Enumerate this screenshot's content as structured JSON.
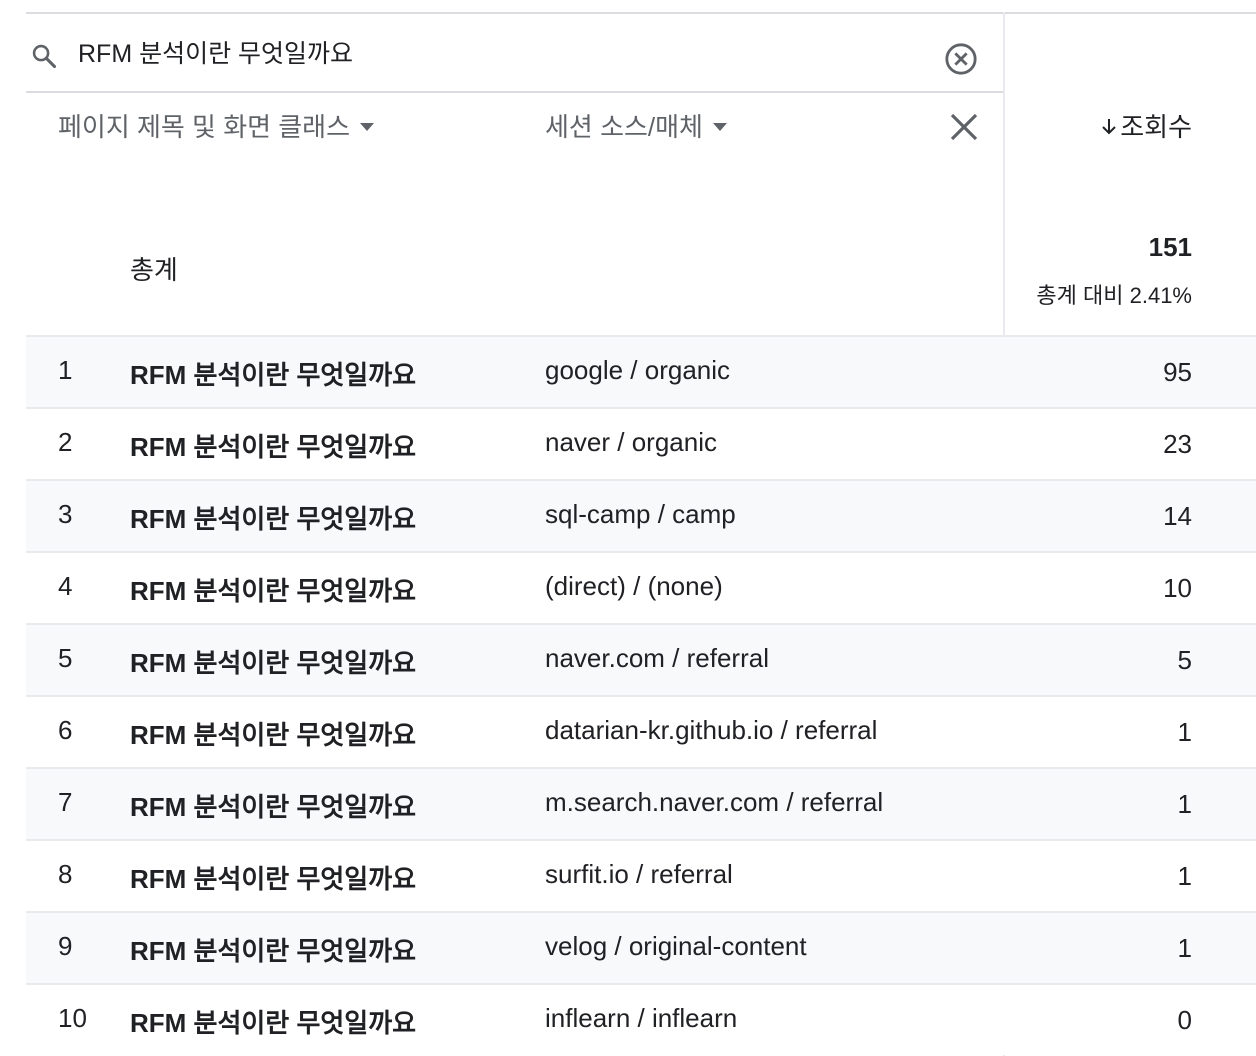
{
  "search": {
    "value": "RFM 분석이란 무엇일까요",
    "placeholder": ""
  },
  "columns": {
    "dimension1": "페이지 제목 및 화면 클래스",
    "dimension2": "세션 소스/매체",
    "metric": "조회수"
  },
  "totals": {
    "label": "총계",
    "value": "151",
    "sub": "총계 대비 2.41%"
  },
  "rows": [
    {
      "index": "1",
      "page": "RFM 분석이란 무엇일까요",
      "source": "google / organic",
      "views": "95"
    },
    {
      "index": "2",
      "page": "RFM 분석이란 무엇일까요",
      "source": "naver / organic",
      "views": "23"
    },
    {
      "index": "3",
      "page": "RFM 분석이란 무엇일까요",
      "source": "sql-camp / camp",
      "views": "14"
    },
    {
      "index": "4",
      "page": "RFM 분석이란 무엇일까요",
      "source": "(direct) / (none)",
      "views": "10"
    },
    {
      "index": "5",
      "page": "RFM 분석이란 무엇일까요",
      "source": "naver.com / referral",
      "views": "5"
    },
    {
      "index": "6",
      "page": "RFM 분석이란 무엇일까요",
      "source": "datarian-kr.github.io / referral",
      "views": "1"
    },
    {
      "index": "7",
      "page": "RFM 분석이란 무엇일까요",
      "source": "m.search.naver.com / referral",
      "views": "1"
    },
    {
      "index": "8",
      "page": "RFM 분석이란 무엇일까요",
      "source": "surfit.io / referral",
      "views": "1"
    },
    {
      "index": "9",
      "page": "RFM 분석이란 무엇일까요",
      "source": "velog / original-content",
      "views": "1"
    },
    {
      "index": "10",
      "page": "RFM 분석이란 무엇일까요",
      "source": "inflearn / inflearn",
      "views": "0"
    }
  ],
  "icons": {
    "search": "search-icon",
    "clear": "clear-circle-icon",
    "remove": "close-icon",
    "sort": "arrow-down-icon",
    "dropdown": "caret-down-icon"
  }
}
